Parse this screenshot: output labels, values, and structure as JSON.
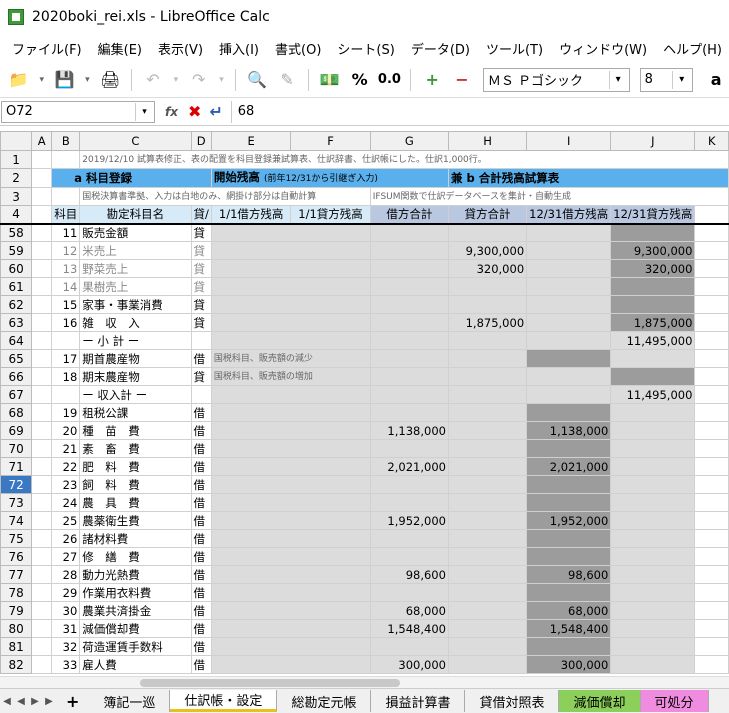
{
  "window": {
    "title": "2020boki_rei.xls - LibreOffice Calc"
  },
  "menu": [
    "ファイル(F)",
    "編集(E)",
    "表示(V)",
    "挿入(I)",
    "書式(O)",
    "シート(S)",
    "データ(D)",
    "ツール(T)",
    "ウィンドウ(W)",
    "ヘルプ(H)"
  ],
  "toolbar": {
    "font_name": "ＭＳ Ｐゴシック",
    "font_size": "8",
    "percent": "%",
    "decimal": "0.0"
  },
  "formula": {
    "cell_ref": "O72",
    "content": "68",
    "fx": "fx"
  },
  "columns": [
    "",
    "A",
    "B",
    "C",
    "D",
    "E",
    "F",
    "G",
    "H",
    "I",
    "J",
    "K"
  ],
  "header_rows": {
    "r1": "2019/12/10 試算表修正、表の配置を科目登録兼試算表、仕訳辞書、仕訳帳にした。仕訳1,000行。",
    "r2_a": "a 科目登録",
    "r2_e": "開始残高",
    "r2_e_sub": "(前年12/31から引継ぎ入力)",
    "r2_h": "兼 b 合計残高試算表",
    "r3_c": "国税決算書準拠、入力は白地のみ、網掛け部分は自動計算",
    "r3_g": "IFSUM関数で仕訳データベースを集計・自動生成",
    "r4": [
      "科目",
      "勘定科目名",
      "貸/",
      "1/1借方残高",
      "1/1貸方残高",
      "借方合計",
      "貸方合計",
      "12/31借方残高",
      "12/31貸方残高"
    ]
  },
  "rows": [
    {
      "n": "58",
      "b": "11",
      "c": "販売金額",
      "d": "貸",
      "e": "",
      "g": "",
      "h": "",
      "i": "",
      "j": ""
    },
    {
      "n": "59",
      "b": "12",
      "c": "米売上",
      "d": "貸",
      "e": "",
      "g": "",
      "h": "9,300,000",
      "i": "",
      "j": "9,300,000",
      "faded": true
    },
    {
      "n": "60",
      "b": "13",
      "c": "野菜売上",
      "d": "貸",
      "e": "",
      "g": "",
      "h": "320,000",
      "i": "",
      "j": "320,000",
      "faded": true
    },
    {
      "n": "61",
      "b": "14",
      "c": "果樹売上",
      "d": "貸",
      "e": "",
      "g": "",
      "h": "",
      "i": "",
      "j": "",
      "faded": true
    },
    {
      "n": "62",
      "b": "15",
      "c": "家事・事業消費",
      "d": "貸",
      "e": "",
      "g": "",
      "h": "",
      "i": "",
      "j": ""
    },
    {
      "n": "63",
      "b": "16",
      "c": "雑　収　入",
      "d": "貸",
      "e": "",
      "g": "",
      "h": "1,875,000",
      "i": "",
      "j": "1,875,000"
    },
    {
      "n": "64",
      "b": "",
      "c": "ー 小 計 ー",
      "d": "",
      "e": "",
      "g": "",
      "h": "",
      "i": "",
      "j": "11,495,000"
    },
    {
      "n": "65",
      "b": "17",
      "c": "期首農産物",
      "d": "借",
      "e": "国税科目、販売額の減少",
      "g": "",
      "h": "",
      "i": "",
      "j": ""
    },
    {
      "n": "66",
      "b": "18",
      "c": "期末農産物",
      "d": "貸",
      "e": "国税科目、販売額の増加",
      "g": "",
      "h": "",
      "i": "",
      "j": ""
    },
    {
      "n": "67",
      "b": "",
      "c": "ー 収入計 ー",
      "d": "",
      "e": "",
      "g": "",
      "h": "",
      "i": "",
      "j": "11,495,000"
    },
    {
      "n": "68",
      "b": "19",
      "c": "租税公課",
      "d": "借",
      "e": "",
      "g": "",
      "h": "",
      "i": "",
      "j": ""
    },
    {
      "n": "69",
      "b": "20",
      "c": "種　苗　費",
      "d": "借",
      "e": "",
      "g": "1,138,000",
      "h": "",
      "i": "1,138,000",
      "j": ""
    },
    {
      "n": "70",
      "b": "21",
      "c": "素　畜　費",
      "d": "借",
      "e": "",
      "g": "",
      "h": "",
      "i": "",
      "j": ""
    },
    {
      "n": "71",
      "b": "22",
      "c": "肥　料　費",
      "d": "借",
      "e": "",
      "g": "2,021,000",
      "h": "",
      "i": "2,021,000",
      "j": ""
    },
    {
      "n": "72",
      "b": "23",
      "c": "飼　料　費",
      "d": "借",
      "e": "",
      "g": "",
      "h": "",
      "i": "",
      "j": "",
      "sel": true
    },
    {
      "n": "73",
      "b": "24",
      "c": "農　具　費",
      "d": "借",
      "e": "",
      "g": "",
      "h": "",
      "i": "",
      "j": ""
    },
    {
      "n": "74",
      "b": "25",
      "c": "農薬衛生費",
      "d": "借",
      "e": "",
      "g": "1,952,000",
      "h": "",
      "i": "1,952,000",
      "j": ""
    },
    {
      "n": "75",
      "b": "26",
      "c": "諸材料費",
      "d": "借",
      "e": "",
      "g": "",
      "h": "",
      "i": "",
      "j": ""
    },
    {
      "n": "76",
      "b": "27",
      "c": "修　繕　費",
      "d": "借",
      "e": "",
      "g": "",
      "h": "",
      "i": "",
      "j": ""
    },
    {
      "n": "77",
      "b": "28",
      "c": "動力光熱費",
      "d": "借",
      "e": "",
      "g": "98,600",
      "h": "",
      "i": "98,600",
      "j": ""
    },
    {
      "n": "78",
      "b": "29",
      "c": "作業用衣料費",
      "d": "借",
      "e": "",
      "g": "",
      "h": "",
      "i": "",
      "j": ""
    },
    {
      "n": "79",
      "b": "30",
      "c": "農業共済掛金",
      "d": "借",
      "e": "",
      "g": "68,000",
      "h": "",
      "i": "68,000",
      "j": ""
    },
    {
      "n": "80",
      "b": "31",
      "c": "減価償却費",
      "d": "借",
      "e": "",
      "g": "1,548,400",
      "h": "",
      "i": "1,548,400",
      "j": ""
    },
    {
      "n": "81",
      "b": "32",
      "c": "荷造運賃手数料",
      "d": "借",
      "e": "",
      "g": "",
      "h": "",
      "i": "",
      "j": ""
    },
    {
      "n": "82",
      "b": "33",
      "c": "雇人費",
      "d": "借",
      "e": "",
      "g": "300,000",
      "h": "",
      "i": "300,000",
      "j": ""
    }
  ],
  "tabs": [
    "簿記一巡",
    "仕訳帳・設定",
    "総勘定元帳",
    "損益計算書",
    "貸借対照表",
    "減価償却",
    "可処分"
  ]
}
